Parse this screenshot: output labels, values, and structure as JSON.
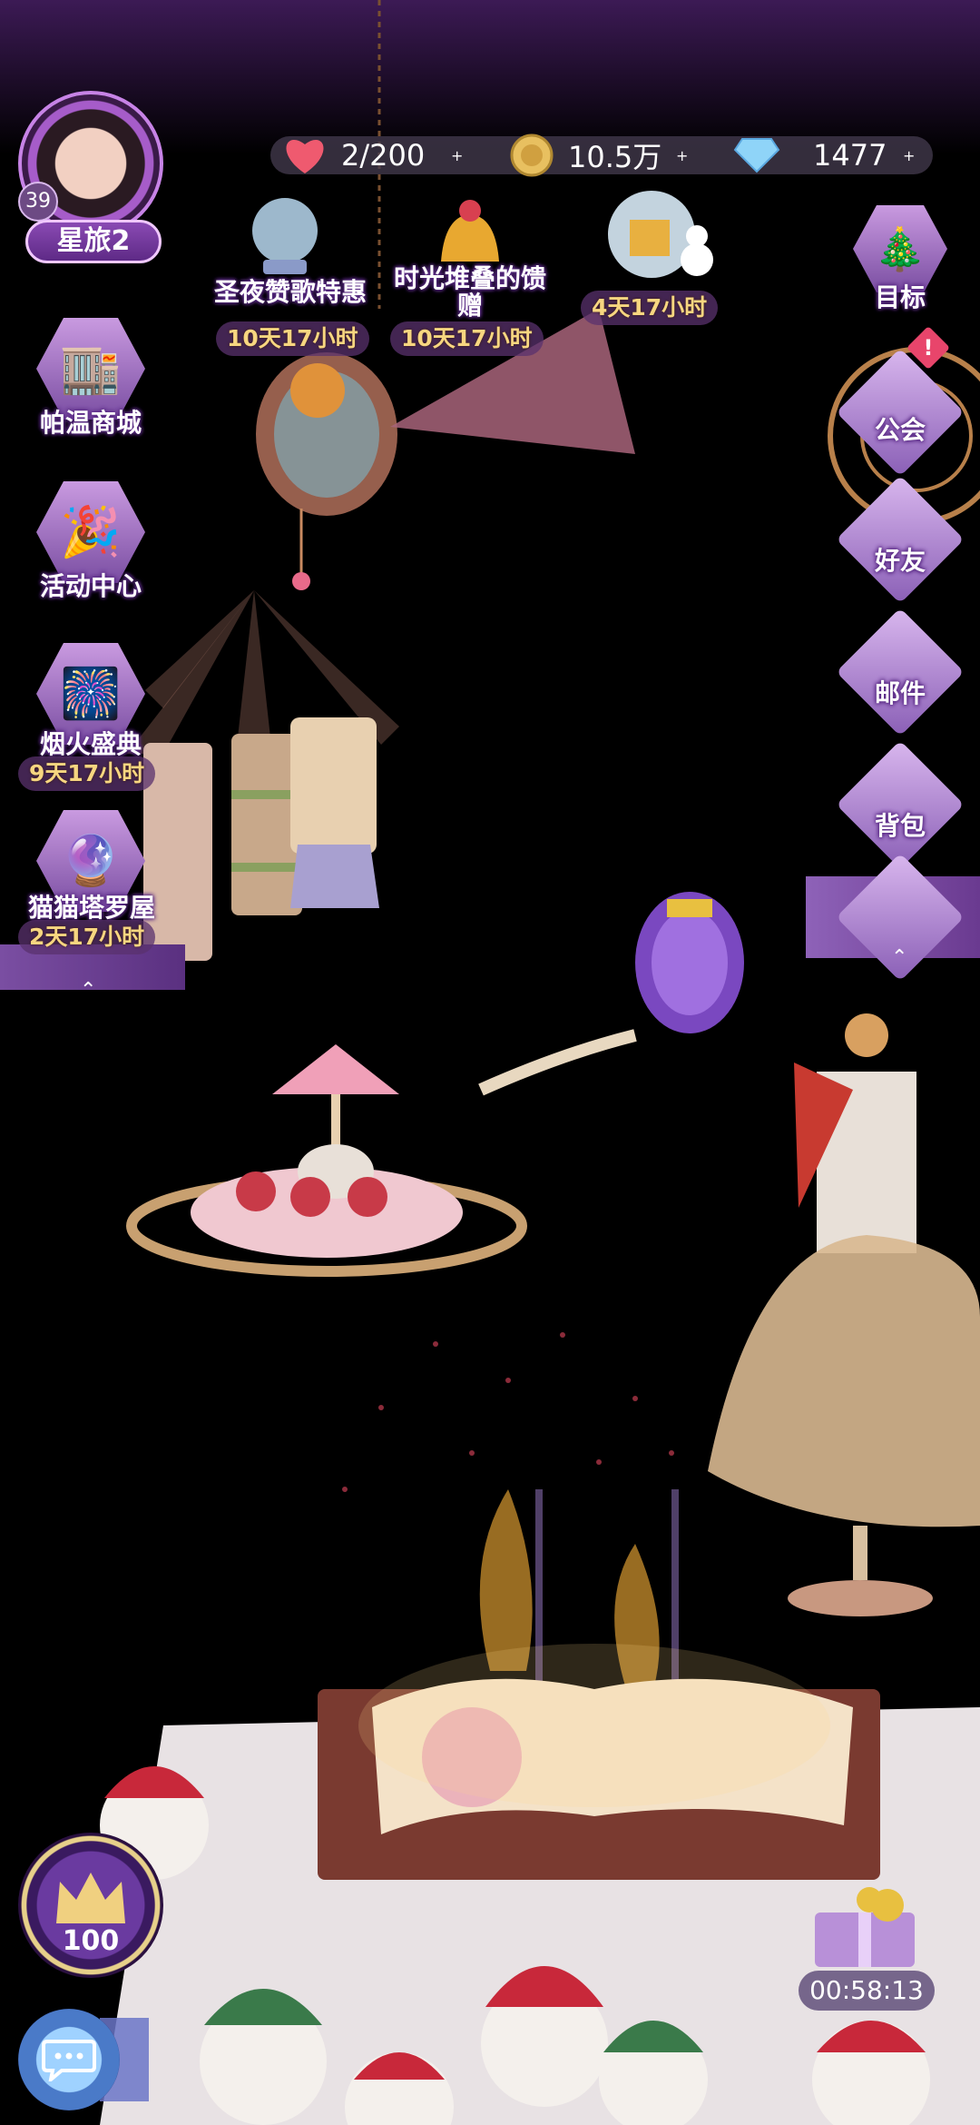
{
  "resources": {
    "hearts": "2/200",
    "coins": "10.5万",
    "diamonds": "1477",
    "plus": "+"
  },
  "player": {
    "level": "39",
    "name": "星旅2"
  },
  "events": [
    {
      "label": "圣夜赞歌特惠",
      "timer": "10天17小时"
    },
    {
      "label": "时光堆叠的馈赠",
      "timer": "10天17小时"
    },
    {
      "label": "",
      "timer": "4天17小时"
    }
  ],
  "left_menu": [
    {
      "label": "帕温商城",
      "icon": "shop-icon",
      "timer": ""
    },
    {
      "label": "活动中心",
      "icon": "activity-icon",
      "timer": ""
    },
    {
      "label": "烟火盛典",
      "icon": "fireworks-icon",
      "timer": "9天17小时"
    },
    {
      "label": "猫猫塔罗屋",
      "icon": "tarot-icon",
      "timer": "2天17小时"
    }
  ],
  "right_menu": [
    {
      "label": "目标",
      "icon": "target-icon"
    },
    {
      "label": "公会",
      "icon": "guild-icon"
    },
    {
      "label": "好友",
      "icon": "friends-icon"
    },
    {
      "label": "邮件",
      "icon": "mail-icon"
    },
    {
      "label": "背包",
      "icon": "bag-icon"
    },
    {
      "label": "",
      "icon": "menu-icon"
    }
  ],
  "crown_level": "100",
  "gift_timer": "00:58:13",
  "colors": {
    "accent_purple": "#8a4ab4",
    "timer_gold": "#f7d680",
    "badge_red": "#e8456b"
  }
}
